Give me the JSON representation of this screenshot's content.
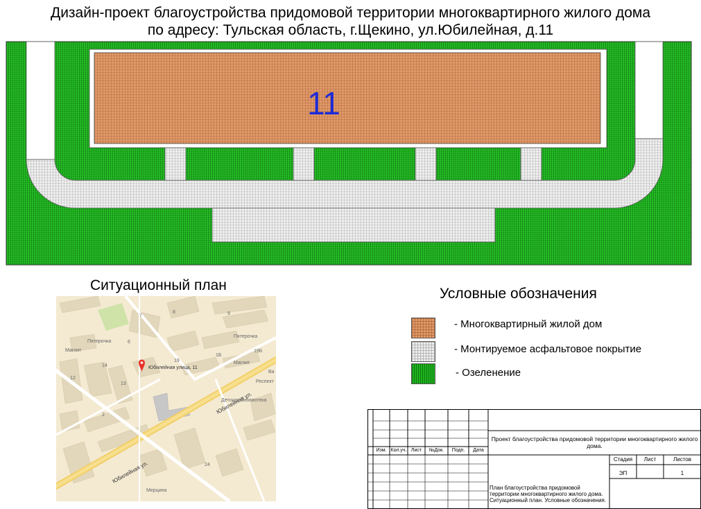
{
  "title": {
    "line1": "Дизайн-проект благоустройства придомовой территории многоквартирного жилого дома",
    "line2": "по адресу: Тульская область, г.Щекино, ул.Юбилейная, д.11"
  },
  "plan": {
    "house_number": "11"
  },
  "situation": {
    "title": "Ситуационный план",
    "labels": {
      "marker": "Юбилейная улица, 11",
      "street1": "Юбилейная ул.",
      "street2": "Юбилейная ул.",
      "library": "Детская библиотека",
      "pyaterochka1": "Пятерочка",
      "pyaterochka2": "Пятерочка",
      "magnit1": "Магнит",
      "magnit2": "Магнит",
      "respekt": "Респект",
      "merishna": "Мерцина",
      "n14": "14",
      "n12": "12",
      "n13": "13",
      "n19": "19",
      "n1b": "1Б",
      "n2": "2",
      "n24": "24",
      "n7": "7",
      "n8": "8",
      "n9": "9",
      "n6": "6",
      "n19b": "19Б",
      "nva": "Ва"
    }
  },
  "legend": {
    "title": "Условные обозначения",
    "items": [
      {
        "label": "- Многоквартирный жилой дом",
        "color": "#e0996a"
      },
      {
        "label": "- Монтируемое асфальтовое покрытие",
        "color": "#eeeeee"
      },
      {
        "label": "- Озеленение",
        "color": "#1fb21f"
      }
    ]
  },
  "stamp": {
    "headers": [
      "Изм.",
      "Кол.уч.",
      "Лист",
      "№Док.",
      "Подп.",
      "Дата"
    ],
    "project_title": "Проект благоустройства придомовой территории многоквартирного жилого дома.",
    "stage_label": "Стадия",
    "sheet_label": "Лист",
    "sheets_label": "Листов",
    "stage_value": "ЭП",
    "sheet_value": "",
    "sheets_value": "1",
    "sheet_title": "План благоустройства придомовой территории многоквартирного жилого дома. Ситуационный план. Условные обозначения."
  }
}
